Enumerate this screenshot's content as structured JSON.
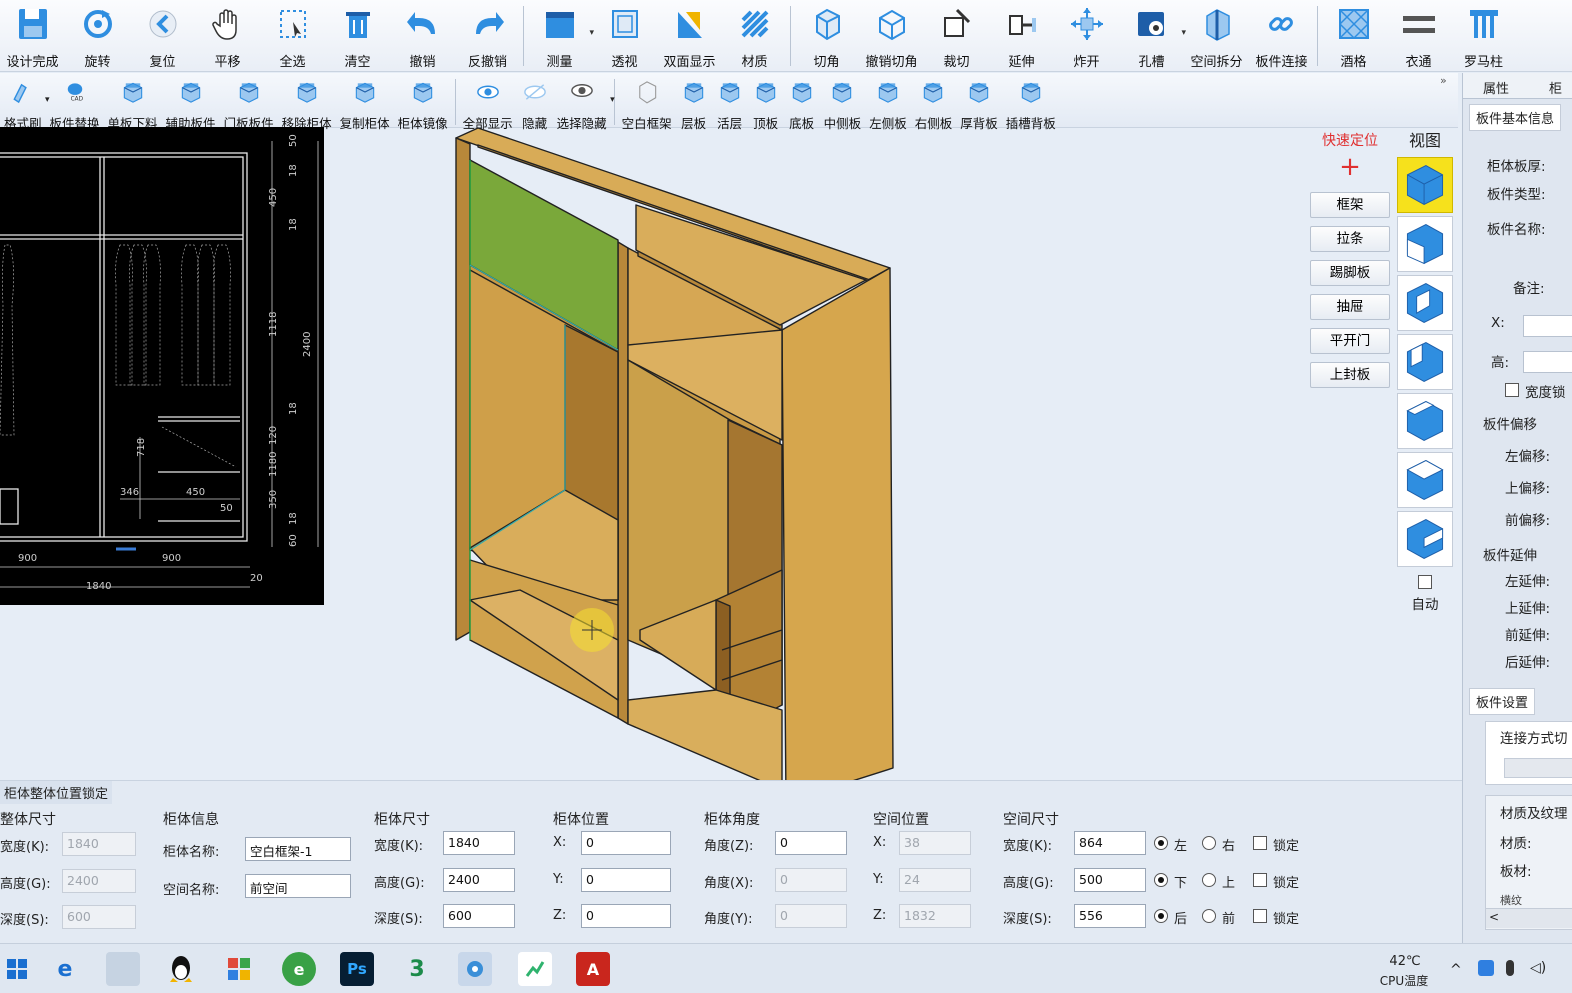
{
  "toolbar1": [
    {
      "label": "设计完成",
      "icon": "save-icon"
    },
    {
      "label": "旋转",
      "icon": "rotate-icon"
    },
    {
      "label": "复位",
      "icon": "reset-icon"
    },
    {
      "label": "平移",
      "icon": "hand-icon"
    },
    {
      "label": "全选",
      "icon": "select-all-icon"
    },
    {
      "label": "清空",
      "icon": "trash-icon"
    },
    {
      "label": "撤销",
      "icon": "undo-icon"
    },
    {
      "label": "反撤销",
      "icon": "redo-icon"
    },
    {
      "label": "测量",
      "icon": "measure-icon"
    },
    {
      "label": "透视",
      "icon": "perspective-icon"
    },
    {
      "label": "双面显示",
      "icon": "double-side-icon"
    },
    {
      "label": "材质",
      "icon": "material-icon"
    },
    {
      "label": "切角",
      "icon": "chamfer-icon"
    },
    {
      "label": "撤销切角",
      "icon": "undo-chamfer-icon"
    },
    {
      "label": "裁切",
      "icon": "cut-icon"
    },
    {
      "label": "延伸",
      "icon": "extend-icon"
    },
    {
      "label": "炸开",
      "icon": "explode-icon"
    },
    {
      "label": "孔槽",
      "icon": "hole-slot-icon"
    },
    {
      "label": "空间拆分",
      "icon": "space-split-icon"
    },
    {
      "label": "板件连接",
      "icon": "panel-connect-icon"
    },
    {
      "label": "酒格",
      "icon": "wine-rack-icon"
    },
    {
      "label": "衣通",
      "icon": "hanging-rod-icon"
    },
    {
      "label": "罗马柱",
      "icon": "roman-column-icon"
    }
  ],
  "toolbar2": [
    {
      "label": "格式刷",
      "icon": "format-brush-icon"
    },
    {
      "label": "板件替换",
      "icon": "panel-replace-icon"
    },
    {
      "label": "单板下料",
      "icon": "single-board-icon"
    },
    {
      "label": "辅助板件",
      "icon": "aux-panel-icon"
    },
    {
      "label": "门板板件",
      "icon": "door-panel-icon"
    },
    {
      "label": "移除柜体",
      "icon": "remove-cabinet-icon"
    },
    {
      "label": "复制柜体",
      "icon": "copy-cabinet-icon"
    },
    {
      "label": "柜体镜像",
      "icon": "mirror-cabinet-icon"
    },
    {
      "label": "全部显示",
      "icon": "eye-icon"
    },
    {
      "label": "隐藏",
      "icon": "eye-hidden-icon"
    },
    {
      "label": "选择隐藏",
      "icon": "select-hide-icon"
    },
    {
      "label": "空白框架",
      "icon": "blank-frame-icon"
    },
    {
      "label": "层板",
      "icon": "shelf-icon"
    },
    {
      "label": "活层",
      "icon": "movable-shelf-icon"
    },
    {
      "label": "顶板",
      "icon": "top-panel-icon"
    },
    {
      "label": "底板",
      "icon": "bottom-panel-icon"
    },
    {
      "label": "中侧板",
      "icon": "middle-side-icon"
    },
    {
      "label": "左侧板",
      "icon": "left-side-icon"
    },
    {
      "label": "右侧板",
      "icon": "right-side-icon"
    },
    {
      "label": "厚背板",
      "icon": "thick-back-icon"
    },
    {
      "label": "插槽背板",
      "icon": "slot-back-icon"
    }
  ],
  "cad": {
    "dims_right": [
      "50",
      "18",
      "450",
      "18",
      "1118",
      "2400",
      "18",
      "718",
      "1180",
      "120",
      "350",
      "18",
      "60"
    ],
    "dims_bottom": [
      "900",
      "900",
      "1840",
      "346",
      "450",
      "50",
      "20"
    ]
  },
  "quick": {
    "title": "快速定位",
    "plus": "+",
    "buttons": [
      "框架",
      "拉条",
      "踢脚板",
      "抽屉",
      "平开门",
      "上封板"
    ]
  },
  "views": {
    "title": "视图",
    "auto": "自动",
    "selected_index": 0
  },
  "right_panel": {
    "tab1": "属性",
    "tab2": "柜",
    "sec_basic": "板件基本信息",
    "thick": "柜体板厚:",
    "type": "板件类型:",
    "name": "板件名称:",
    "note": "备注:",
    "x": "X:",
    "h": "高:",
    "width_lock": "宽度锁",
    "sec_offset": "板件偏移",
    "off_left": "左偏移:",
    "off_top": "上偏移:",
    "off_front": "前偏移:",
    "sec_extend": "板件延伸",
    "ext_left": "左延伸:",
    "ext_top": "上延伸:",
    "ext_front": "前延伸:",
    "ext_back": "后延伸:",
    "sec_setting": "板件设置",
    "connect": "连接方式切",
    "sec_material": "材质及纹理",
    "material": "材质:",
    "board": "板材:",
    "grain": "横纹",
    "scroll_left": "<"
  },
  "bottom": {
    "title": "柜体整体位置锁定",
    "overall": {
      "h": "整体尺寸",
      "w_l": "宽度(K):",
      "w": "1840",
      "g_l": "高度(G):",
      "g": "2400",
      "s_l": "深度(S):",
      "s": "600"
    },
    "info": {
      "h": "柜体信息",
      "name_l": "柜体名称:",
      "name": "空白框架-1",
      "space_l": "空间名称:",
      "space": "前空间"
    },
    "size": {
      "h": "柜体尺寸",
      "w_l": "宽度(K):",
      "w": "1840",
      "g_l": "高度(G):",
      "g": "2400",
      "s_l": "深度(S):",
      "s": "600"
    },
    "pos": {
      "h": "柜体位置",
      "x_l": "X:",
      "x": "0",
      "y_l": "Y:",
      "y": "0",
      "z_l": "Z:",
      "z": "0"
    },
    "angle": {
      "h": "柜体角度",
      "z_l": "角度(Z):",
      "z": "0",
      "x_l": "角度(X):",
      "x": "0",
      "y_l": "角度(Y):",
      "y": "0"
    },
    "spos": {
      "h": "空间位置",
      "x_l": "X:",
      "x": "38",
      "y_l": "Y:",
      "y": "24",
      "z_l": "Z:",
      "z": "1832"
    },
    "ssize": {
      "h": "空间尺寸",
      "w_l": "宽度(K):",
      "w": "864",
      "g_l": "高度(G):",
      "g": "500",
      "s_l": "深度(S):",
      "s": "556",
      "left": "左",
      "right": "右",
      "down": "下",
      "up": "上",
      "back": "后",
      "front": "前",
      "lock": "锁定"
    }
  },
  "taskbar": {
    "temp": "42℃",
    "temp_label": "CPU温度"
  },
  "colors": {
    "wood": "#d4a54a",
    "wood_dark": "#b9873a",
    "green": "#7aa83a",
    "accent": "#2f8ee0",
    "yellow": "#f6e11c"
  }
}
